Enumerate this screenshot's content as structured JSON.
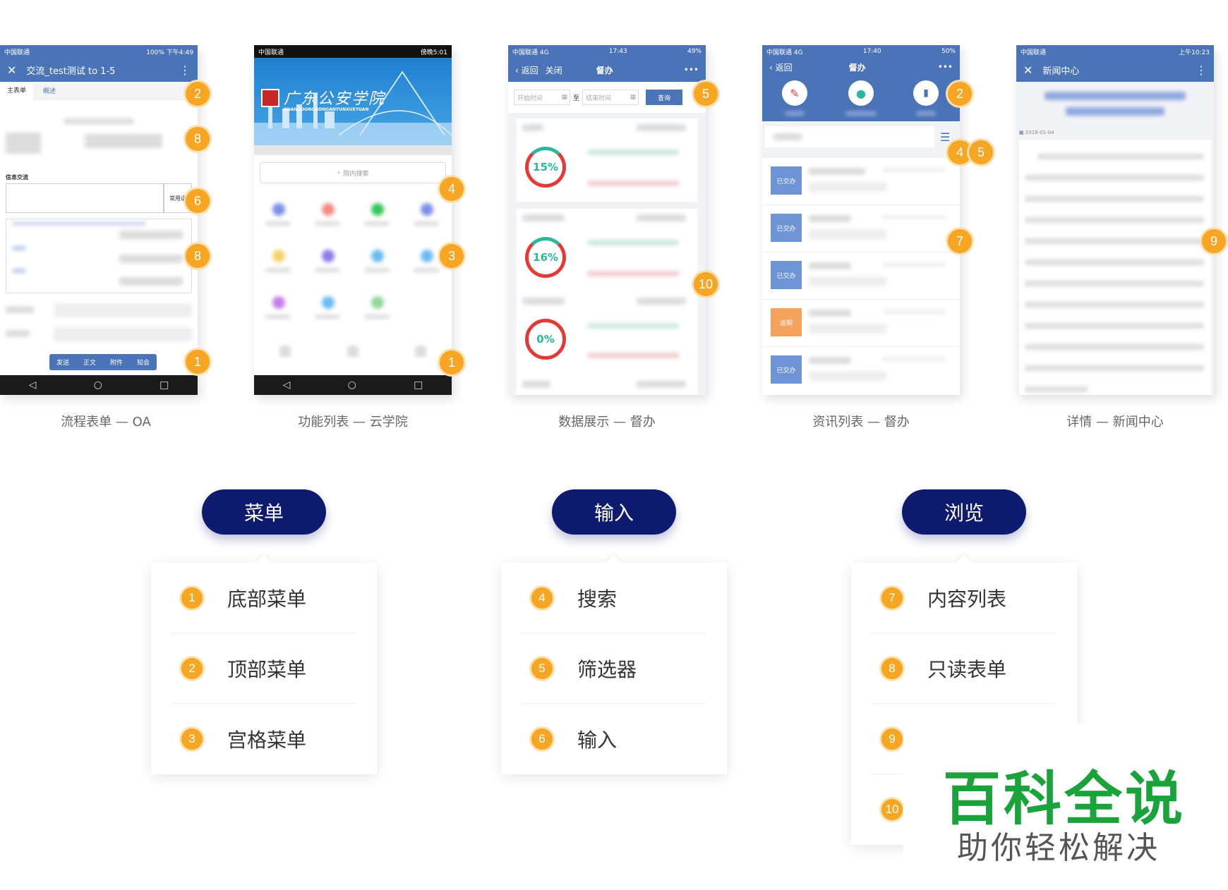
{
  "screens": [
    {
      "status_left": "中国联通",
      "status_right": "100% 下午4:49",
      "title": "交流_test测试 to 1-5",
      "tab1": "主表单",
      "tab2": "概述",
      "section": "信息交流",
      "common": "常用语",
      "buttons": [
        "发送",
        "正文",
        "附件",
        "知会"
      ],
      "caption": "流程表单 — OA"
    },
    {
      "status_left": "中国联通",
      "status_right": "傍晚5:01",
      "banner_title": "广东公安学院",
      "banner_sub": "GUANGDONGGONGANYUNXUEYUAN",
      "search": "院内搜索",
      "caption": "功能列表 — 云学院"
    },
    {
      "status_left": "中国联通 4G",
      "status_time": "17:43",
      "status_right": "49%",
      "back": "返回",
      "close": "关闭",
      "title": "督办",
      "more": "•••",
      "start": "开始时间",
      "to": "至",
      "end": "结束时间",
      "query": "查询",
      "rings": [
        "15%",
        "16%",
        "0%"
      ],
      "caption": "数据展示 — 督办"
    },
    {
      "status_left": "中国联通 4G",
      "status_time": "17:40",
      "status_right": "50%",
      "back": "返回",
      "title": "督办",
      "more": "•••",
      "tags": [
        "已交办",
        "已交办",
        "已交办",
        "逾期",
        "已交办"
      ],
      "caption": "资讯列表 — 督办"
    },
    {
      "status_left": "中国联通",
      "status_right": "上午10:23",
      "title": "新闻中心",
      "date": "2018-01-04",
      "caption": "详情 — 新闻中心"
    }
  ],
  "badges": {
    "s1": [
      "2",
      "8",
      "6",
      "8",
      "1"
    ],
    "s2": [
      "4",
      "3",
      "1"
    ],
    "s3": [
      "5",
      "10"
    ],
    "s4": [
      "2",
      "4",
      "5",
      "7"
    ],
    "s5": [
      "9"
    ]
  },
  "groups": [
    {
      "title": "菜单",
      "items": [
        {
          "num": "1",
          "label": "底部菜单"
        },
        {
          "num": "2",
          "label": "顶部菜单"
        },
        {
          "num": "3",
          "label": "宫格菜单"
        }
      ]
    },
    {
      "title": "输入",
      "items": [
        {
          "num": "4",
          "label": "搜索"
        },
        {
          "num": "5",
          "label": "筛选器"
        },
        {
          "num": "6",
          "label": "输入"
        }
      ]
    },
    {
      "title": "浏览",
      "items": [
        {
          "num": "7",
          "label": "内容列表"
        },
        {
          "num": "8",
          "label": "只读表单"
        },
        {
          "num": "9",
          "label": ""
        },
        {
          "num": "10",
          "label": ""
        }
      ]
    }
  ],
  "watermark": {
    "title": "百科全说",
    "subtitle": "助你轻松解决"
  },
  "colors": {
    "navy": "#0e1a6e",
    "orange": "#f6a623",
    "blue": "#4b73b8",
    "green_watermark": "#1aa33a"
  }
}
